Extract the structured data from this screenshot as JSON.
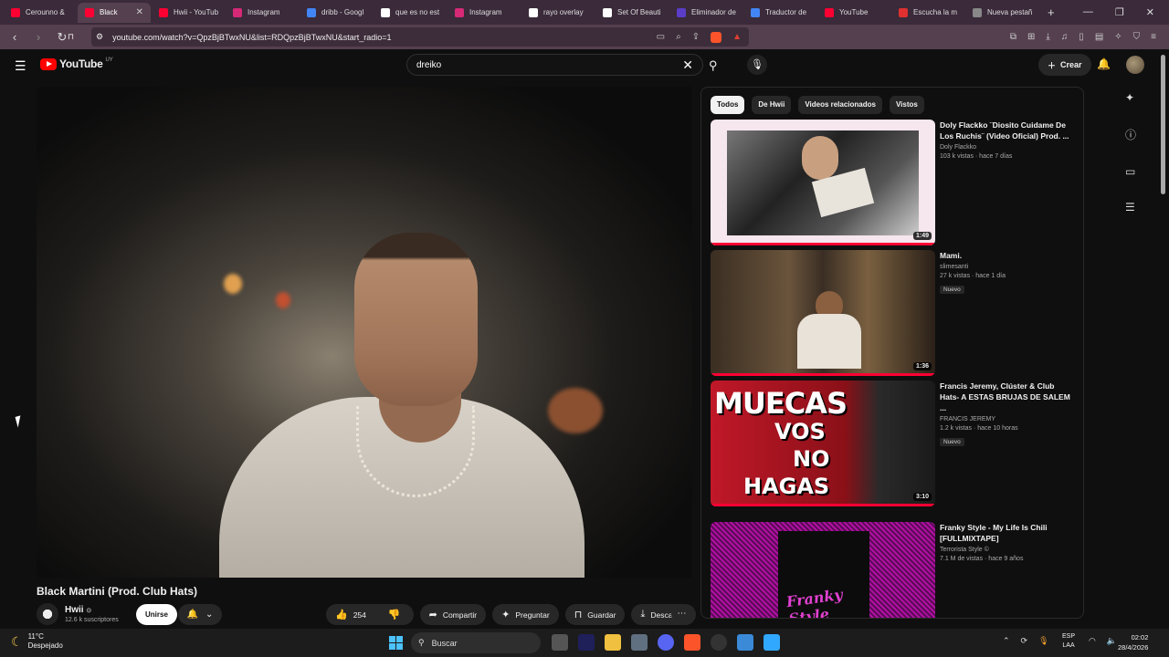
{
  "browser": {
    "tabs": [
      {
        "label": "Cerounno &",
        "color": "#ff0033"
      },
      {
        "label": "Black",
        "color": "#ff0033",
        "active": true
      },
      {
        "label": "Hwii - YouTub",
        "color": "#ff0033"
      },
      {
        "label": "Instagram",
        "color": "#d62976"
      },
      {
        "label": "dribb - Googl",
        "color": "#4285f4"
      },
      {
        "label": "que es no est",
        "color": "#ffffff"
      },
      {
        "label": "Instagram",
        "color": "#d62976"
      },
      {
        "label": "rayo overlay",
        "color": "#ffffff"
      },
      {
        "label": "Set Of Beauti",
        "color": "#ffffff"
      },
      {
        "label": "Eliminador de",
        "color": "#5a3ec8"
      },
      {
        "label": "Traductor de",
        "color": "#4285f4"
      },
      {
        "label": "YouTube",
        "color": "#ff0033"
      },
      {
        "label": "Escucha la m",
        "color": "#e03030"
      },
      {
        "label": "Nueva pestañ",
        "color": "#888888"
      }
    ],
    "url": "youtube.com/watch?v=QpzBjBTwxNU&list=RDQpzBjBTwxNU&start_radio=1"
  },
  "header": {
    "logo_text": "YouTube",
    "country_code": "UY",
    "search_value": "dreiko",
    "create_label": "Crear"
  },
  "video": {
    "title": "Black Martini (Prod. Club Hats)",
    "channel": "Hwii",
    "subscribers": "12.6 k suscriptores",
    "join_label": "Unirse",
    "likes": "254",
    "share_label": "Compartir",
    "ask_label": "Preguntar",
    "save_label": "Guardar",
    "download_label": "Descargar"
  },
  "panel": {
    "chips": [
      "Todos",
      "De Hwii",
      "Videos relacionados",
      "Vistos"
    ],
    "items": [
      {
        "title": "Doly Flackko ¨Diosito Cuidame De Los Ruchis¨ (Video Oficial) Prod. ...",
        "channel": "Doly Flackko",
        "stats": "103 k vistas · hace 7 días",
        "duration": "1:49",
        "badge": ""
      },
      {
        "title": "Mami.",
        "channel": "slimesanti",
        "stats": "27 k vistas · hace 1 día",
        "duration": "1:36",
        "badge": "Nuevo"
      },
      {
        "title": "Francis Jeremy, Clúster & Club Hats- A ESTAS BRUJAS DE SALEM ...",
        "channel": "FRANCIS JEREMY",
        "stats": "1.2 k vistas · hace 10 horas",
        "duration": "3:10",
        "badge": "Nuevo"
      },
      {
        "title": "Franky Style - My Life Is Chili [FULLMIXTAPE]",
        "channel": "Terrorista Style ©",
        "stats": "7.1 M de vistas · hace 9 años",
        "duration": "",
        "badge": ""
      }
    ],
    "thumb3_text": [
      "MUECAS",
      "VOS",
      "NO",
      "HAGAS"
    ],
    "thumb4_text": "Franky Style"
  },
  "taskbar": {
    "temp": "11°C",
    "weather": "Despejado",
    "search_placeholder": "Buscar",
    "lang1": "ESP",
    "lang2": "LAA",
    "time": "02:02",
    "date": "28/4/2026"
  }
}
